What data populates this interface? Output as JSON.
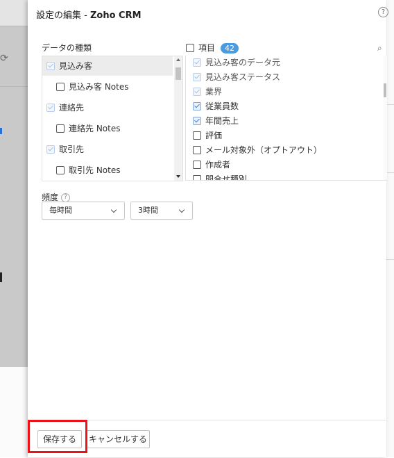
{
  "dialog": {
    "title_prefix": "設定の編集 - ",
    "title_app": "Zoho CRM",
    "help": "?"
  },
  "data_types": {
    "label": "データの種類",
    "items": [
      {
        "label": "見込み客",
        "checked": true,
        "disabled": true,
        "selected": true,
        "indent": false
      },
      {
        "label": "見込み客 Notes",
        "checked": false,
        "indent": true
      },
      {
        "label": "連絡先",
        "checked": true,
        "disabled": true,
        "indent": false
      },
      {
        "label": "連絡先 Notes",
        "checked": false,
        "indent": true
      },
      {
        "label": "取引先",
        "checked": true,
        "disabled": true,
        "indent": false
      },
      {
        "label": "取引先 Notes",
        "checked": false,
        "indent": true
      }
    ]
  },
  "fields": {
    "label": "項目",
    "count": "42",
    "items": [
      {
        "label": "見込み客のデータ元",
        "checked": true,
        "disabled": true
      },
      {
        "label": "見込み客ステータス",
        "checked": true,
        "disabled": true
      },
      {
        "label": "業界",
        "checked": true,
        "disabled": true
      },
      {
        "label": "従業員数",
        "checked": true,
        "disabled": false
      },
      {
        "label": "年間売上",
        "checked": true,
        "disabled": false
      },
      {
        "label": "評価",
        "checked": false
      },
      {
        "label": "メール対象外（オプトアウト）",
        "checked": false
      },
      {
        "label": "作成者",
        "checked": false
      },
      {
        "label": "問合せ種別",
        "checked": false
      }
    ]
  },
  "frequency": {
    "label": "頻度",
    "help": "?",
    "primary": "毎時間",
    "secondary": "3時間"
  },
  "footer": {
    "save": "保存する",
    "cancel": "キャンセルする"
  },
  "colors": {
    "accent": "#4a9be0",
    "highlight": "#e8141a",
    "checkbox": "#4a7fd0"
  }
}
